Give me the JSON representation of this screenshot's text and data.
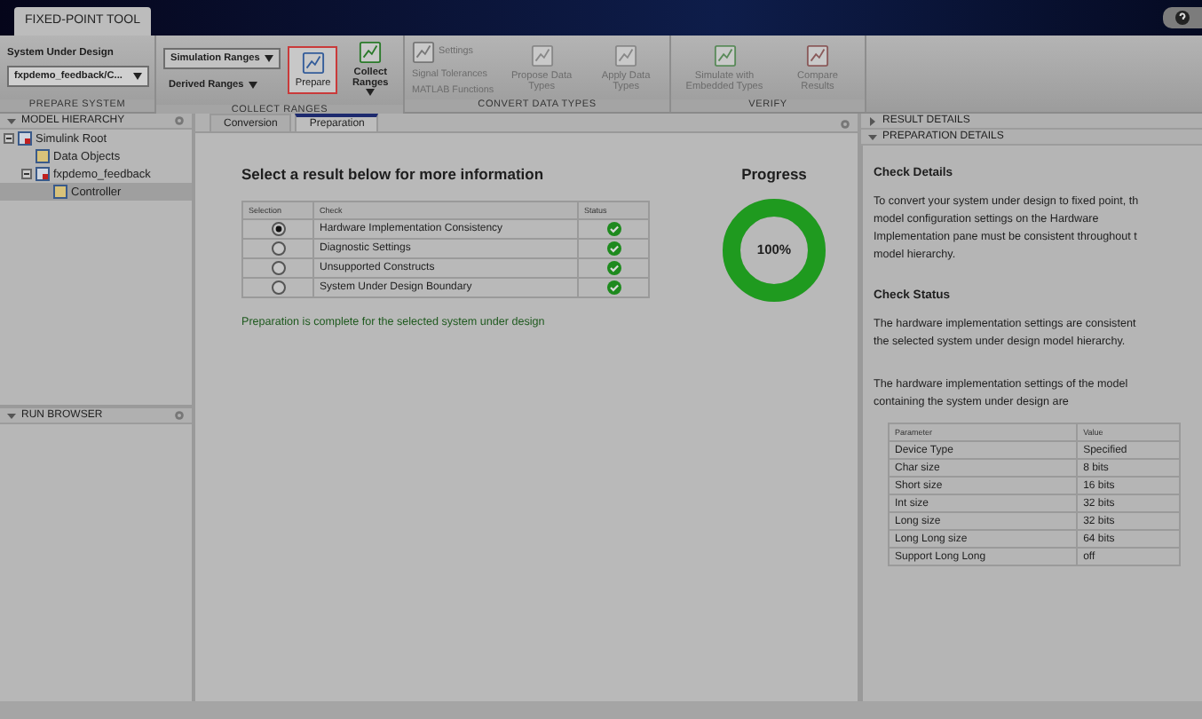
{
  "window": {
    "tab": "FIXED-POINT TOOL"
  },
  "ribbon": {
    "prepare_system": {
      "label": "System Under Design",
      "value": "fxpdemo_feedback/C...",
      "section": "PREPARE SYSTEM"
    },
    "collect_ranges": {
      "range_mode": "Simulation Ranges",
      "derived": "Derived Ranges",
      "prepare": {
        "label": "Prepare",
        "selected": true
      },
      "collect": "Collect Ranges",
      "section": "COLLECT RANGES"
    },
    "convert_data_types": {
      "settings": "Settings",
      "tolerances": "Signal Tolerances",
      "matlab": "MATLAB Functions",
      "propose": "Propose Data Types",
      "apply": "Apply Data Types",
      "section": "CONVERT DATA TYPES"
    },
    "verify": {
      "simulate": "Simulate with Embedded Types",
      "compare": "Compare Results",
      "section": "VERIFY"
    }
  },
  "model_hierarchy": {
    "title": "MODEL HIERARCHY",
    "items": [
      {
        "label": "Simulink Root",
        "expanded": true,
        "selected": false,
        "children": [
          {
            "label": "Data Objects",
            "selected": false
          },
          {
            "label": "fxpdemo_feedback",
            "expanded": true,
            "selected": false,
            "children": [
              {
                "label": "Controller",
                "selected": true
              }
            ]
          }
        ]
      }
    ]
  },
  "run_browser": {
    "title": "RUN BROWSER"
  },
  "tabs": [
    {
      "label": "Conversion",
      "selected": false
    },
    {
      "label": "Preparation",
      "selected": true
    }
  ],
  "preparation": {
    "heading": "Select a result below for more information",
    "table": {
      "columns": [
        "Selection",
        "Check",
        "Status"
      ],
      "rows": [
        {
          "selected": true,
          "check": "Hardware Implementation Consistency",
          "passed": true
        },
        {
          "selected": false,
          "check": "Diagnostic Settings",
          "passed": true
        },
        {
          "selected": false,
          "check": "Unsupported Constructs",
          "passed": true
        },
        {
          "selected": false,
          "check": "System Under Design Boundary",
          "passed": true
        }
      ]
    },
    "message": "Preparation is complete for the selected system under design",
    "progress": {
      "title": "Progress",
      "level": 1,
      "label": "100%"
    }
  },
  "details": {
    "panels": [
      {
        "title": "RESULT DETAILS",
        "expanded": false
      },
      {
        "title": "PREPARATION DETAILS",
        "expanded": true
      }
    ],
    "check_details_heading": "Check Details",
    "check_details_lines": [
      "To convert your system under design to fixed point, th",
      "model configuration settings on the Hardware",
      "Implementation pane must be consistent throughout t",
      "model hierarchy."
    ],
    "check_status_heading": "Check Status",
    "status_lines": [
      "The hardware implementation settings are consistent",
      "the selected system under design model hierarchy."
    ],
    "settings_lines": [
      "The hardware implementation settings of the model",
      "containing the system under design are"
    ],
    "parameters": {
      "columns": [
        "Parameter",
        "Value"
      ],
      "rows": [
        [
          "Device Type",
          "Specified"
        ],
        [
          "Char size",
          "8 bits"
        ],
        [
          "Short size",
          "16 bits"
        ],
        [
          "Int size",
          "32 bits"
        ],
        [
          "Long size",
          "32 bits"
        ],
        [
          "Long Long size",
          "64 bits"
        ],
        [
          "Support Long Long",
          "off"
        ]
      ]
    }
  }
}
